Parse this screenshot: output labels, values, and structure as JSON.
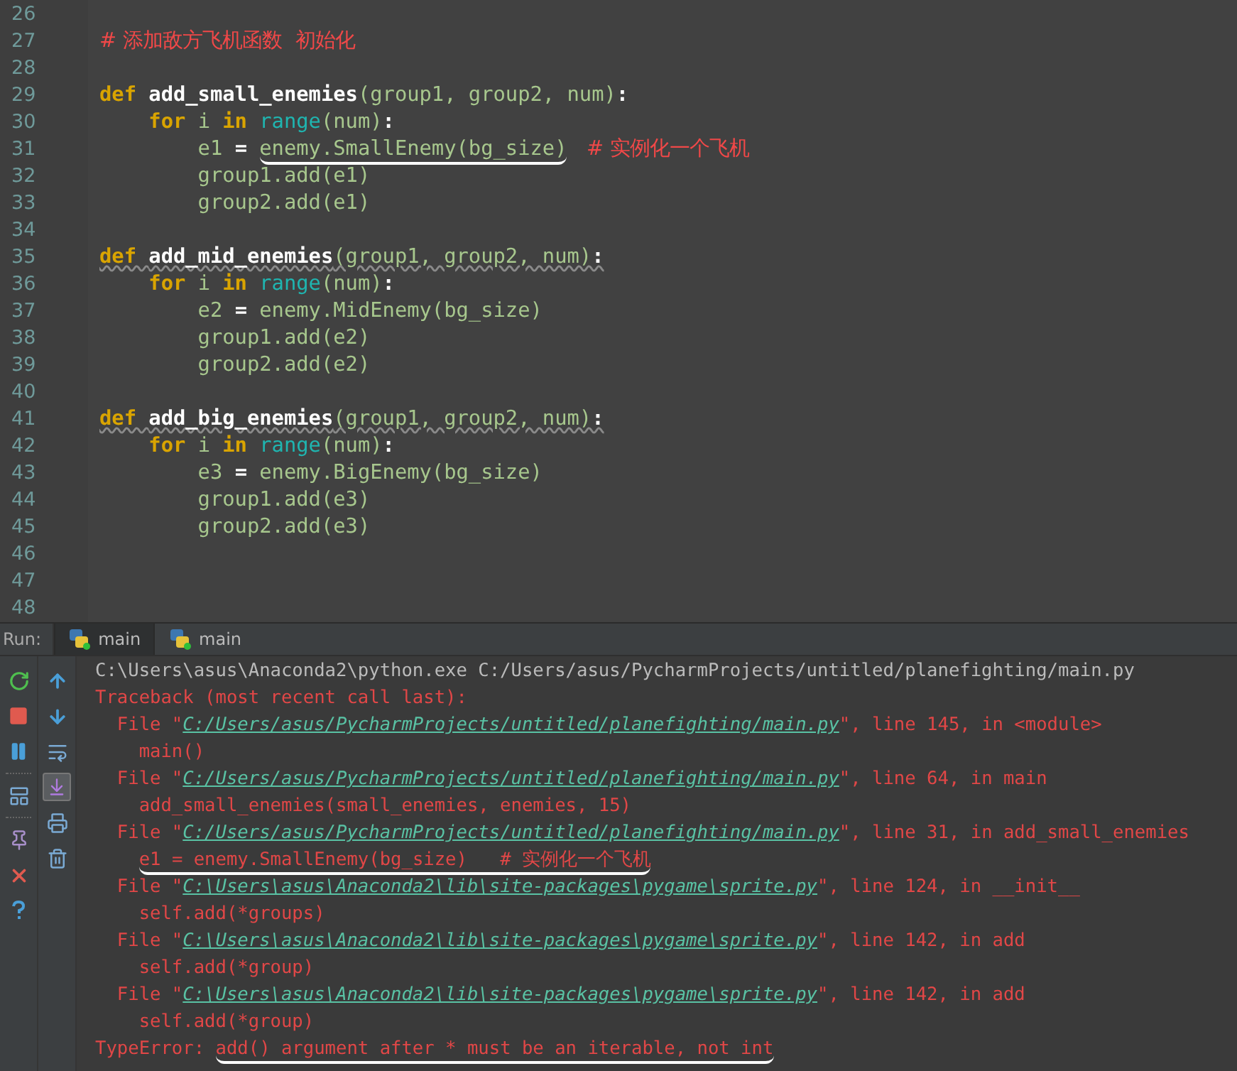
{
  "editor": {
    "lines": [
      {
        "number": "26"
      },
      {
        "number": "27",
        "warning": false,
        "tokens": [
          {
            "kind": "comment",
            "text": "# 添加敌方飞机函数  初始化"
          }
        ]
      },
      {
        "number": "28"
      },
      {
        "number": "29",
        "warning": false,
        "tokens": [
          {
            "kind": "kw",
            "text": "def "
          },
          {
            "kind": "fn",
            "text": "add_small_enemies"
          },
          {
            "kind": "plain",
            "text": "(group1, group2, num)"
          },
          {
            "kind": "op",
            "text": ":"
          }
        ]
      },
      {
        "number": "30",
        "warning": false,
        "tokens": [
          {
            "kind": "kw",
            "text": "    for "
          },
          {
            "kind": "plain",
            "text": "i "
          },
          {
            "kind": "kw",
            "text": "in "
          },
          {
            "kind": "builtin",
            "text": "range"
          },
          {
            "kind": "plain",
            "text": "(num)"
          },
          {
            "kind": "op",
            "text": ":"
          }
        ]
      },
      {
        "number": "31",
        "warning": false,
        "tokens": [
          {
            "kind": "plain",
            "text": "        e1 "
          },
          {
            "kind": "op",
            "text": "= "
          },
          {
            "kind": "plain",
            "text": "enemy.SmallEnemy(bg_size)",
            "underlined": true
          },
          {
            "kind": "comment",
            "text": "   # 实例化一个飞机"
          }
        ]
      },
      {
        "number": "32",
        "warning": false,
        "tokens": [
          {
            "kind": "plain",
            "text": "        group1.add(e1)"
          }
        ]
      },
      {
        "number": "33",
        "warning": false,
        "tokens": [
          {
            "kind": "plain",
            "text": "        group2.add(e1)"
          }
        ]
      },
      {
        "number": "34"
      },
      {
        "number": "35",
        "warning": true,
        "tokens": [
          {
            "kind": "kw",
            "text": "def "
          },
          {
            "kind": "fn",
            "text": "add_mid_enemies"
          },
          {
            "kind": "plain",
            "text": "(group1, group2, num)"
          },
          {
            "kind": "op",
            "text": ":"
          }
        ]
      },
      {
        "number": "36",
        "warning": false,
        "tokens": [
          {
            "kind": "kw",
            "text": "    for "
          },
          {
            "kind": "plain",
            "text": "i "
          },
          {
            "kind": "kw",
            "text": "in "
          },
          {
            "kind": "builtin",
            "text": "range"
          },
          {
            "kind": "plain",
            "text": "(num)"
          },
          {
            "kind": "op",
            "text": ":"
          }
        ]
      },
      {
        "number": "37",
        "warning": false,
        "tokens": [
          {
            "kind": "plain",
            "text": "        e2 "
          },
          {
            "kind": "op",
            "text": "= "
          },
          {
            "kind": "plain",
            "text": "enemy.MidEnemy(bg_size)"
          }
        ]
      },
      {
        "number": "38",
        "warning": false,
        "tokens": [
          {
            "kind": "plain",
            "text": "        group1.add(e2)"
          }
        ]
      },
      {
        "number": "39",
        "warning": false,
        "tokens": [
          {
            "kind": "plain",
            "text": "        group2.add(e2)"
          }
        ]
      },
      {
        "number": "40"
      },
      {
        "number": "41",
        "warning": true,
        "tokens": [
          {
            "kind": "kw",
            "text": "def "
          },
          {
            "kind": "fn",
            "text": "add_big_enemies"
          },
          {
            "kind": "plain",
            "text": "(group1, group2, num)"
          },
          {
            "kind": "op",
            "text": ":"
          }
        ]
      },
      {
        "number": "42",
        "warning": false,
        "tokens": [
          {
            "kind": "kw",
            "text": "    for "
          },
          {
            "kind": "plain",
            "text": "i "
          },
          {
            "kind": "kw",
            "text": "in "
          },
          {
            "kind": "builtin",
            "text": "range"
          },
          {
            "kind": "plain",
            "text": "(num)"
          },
          {
            "kind": "op",
            "text": ":"
          }
        ]
      },
      {
        "number": "43",
        "warning": false,
        "tokens": [
          {
            "kind": "plain",
            "text": "        e3 "
          },
          {
            "kind": "op",
            "text": "= "
          },
          {
            "kind": "plain",
            "text": "enemy.BigEnemy(bg_size)"
          }
        ]
      },
      {
        "number": "44",
        "warning": false,
        "tokens": [
          {
            "kind": "plain",
            "text": "        group1.add(e3)"
          }
        ]
      },
      {
        "number": "45",
        "warning": false,
        "tokens": [
          {
            "kind": "plain",
            "text": "        group2.add(e3)"
          }
        ]
      },
      {
        "number": "46"
      },
      {
        "number": "47"
      },
      {
        "number": "48"
      }
    ]
  },
  "run_bar": {
    "label": "Run:",
    "tabs": [
      {
        "label": "main",
        "selected": true
      },
      {
        "label": "main",
        "selected": false
      }
    ]
  },
  "console": {
    "scroll_to_end": {
      "on": true
    },
    "lines": [
      {
        "tokens": [
          {
            "kind": "cmd",
            "text": "C:\\Users\\asus\\Anaconda2\\python.exe C:/Users/asus/PycharmProjects/untitled/planefighting/main.py"
          }
        ]
      },
      {
        "tokens": [
          {
            "kind": "err",
            "text": "Traceback (most recent call last):"
          }
        ]
      },
      {
        "tokens": [
          {
            "kind": "err",
            "text": "  File \""
          },
          {
            "kind": "link",
            "text": "C:/Users/asus/PycharmProjects/untitled/planefighting/main.py"
          },
          {
            "kind": "err",
            "text": "\", line 145, in <module>"
          }
        ]
      },
      {
        "tokens": [
          {
            "kind": "err",
            "text": "    main()"
          }
        ]
      },
      {
        "tokens": [
          {
            "kind": "err",
            "text": "  File \""
          },
          {
            "kind": "link",
            "text": "C:/Users/asus/PycharmProjects/untitled/planefighting/main.py"
          },
          {
            "kind": "err",
            "text": "\", line 64, in main"
          }
        ]
      },
      {
        "tokens": [
          {
            "kind": "err",
            "text": "    add_small_enemies(small_enemies, enemies, 15)"
          }
        ]
      },
      {
        "tokens": [
          {
            "kind": "err",
            "text": "  File \""
          },
          {
            "kind": "link",
            "text": "C:/Users/asus/PycharmProjects/untitled/planefighting/main.py"
          },
          {
            "kind": "err",
            "text": "\", line 31, in add_small_enemies"
          }
        ]
      },
      {
        "tokens": [
          {
            "kind": "err",
            "text": "    e1 = enemy.SmallEnemy(bg_size)   # 实例化一个飞机",
            "underlined": true
          }
        ]
      },
      {
        "tokens": [
          {
            "kind": "err",
            "text": "  File \""
          },
          {
            "kind": "link",
            "text": "C:\\Users\\asus\\Anaconda2\\lib\\site-packages\\pygame\\sprite.py"
          },
          {
            "kind": "err",
            "text": "\", line 124, in __init__"
          }
        ]
      },
      {
        "tokens": [
          {
            "kind": "err",
            "text": "    self.add(*groups)"
          }
        ]
      },
      {
        "tokens": [
          {
            "kind": "err",
            "text": "  File \""
          },
          {
            "kind": "link",
            "text": "C:\\Users\\asus\\Anaconda2\\lib\\site-packages\\pygame\\sprite.py"
          },
          {
            "kind": "err",
            "text": "\", line 142, in add"
          }
        ]
      },
      {
        "tokens": [
          {
            "kind": "err",
            "text": "    self.add(*group)"
          }
        ]
      },
      {
        "tokens": [
          {
            "kind": "err",
            "text": "  File \""
          },
          {
            "kind": "link",
            "text": "C:\\Users\\asus\\Anaconda2\\lib\\site-packages\\pygame\\sprite.py"
          },
          {
            "kind": "err",
            "text": "\", line 142, in add"
          }
        ]
      },
      {
        "tokens": [
          {
            "kind": "err",
            "text": "    self.add(*group)"
          }
        ]
      },
      {
        "tokens": [
          {
            "kind": "err",
            "text": "TypeError: "
          },
          {
            "kind": "err",
            "text": "add() argument after * must be an iterable, not int",
            "underlined": true
          }
        ]
      }
    ]
  }
}
